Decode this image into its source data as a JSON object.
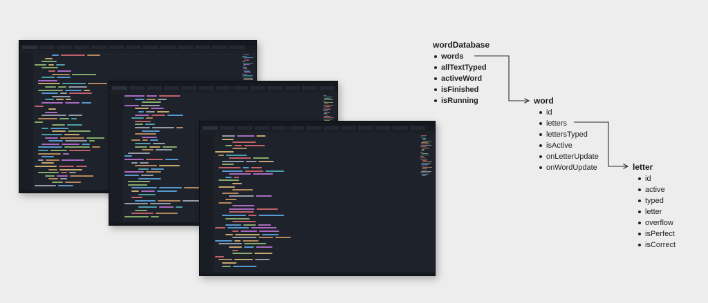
{
  "tree": {
    "wordDatabase": {
      "title": "wordDatabase",
      "items": [
        "words",
        "allTextTyped",
        "activeWord",
        "isFinished",
        "isRunning"
      ]
    },
    "word": {
      "title": "word",
      "items": [
        "id",
        "letters",
        "lettersTyped",
        "isActive",
        "onLetterUpdate",
        "onWordUpdate"
      ]
    },
    "letter": {
      "title": "letter",
      "items": [
        "id",
        "active",
        "typed",
        "letter",
        "overflow",
        "isPerfect",
        "isCorrect"
      ]
    }
  },
  "colors": {
    "background": "#ededed",
    "editor_bg": "#1e222a",
    "text": "#1b1b1b",
    "connector": "#2a2a2a"
  }
}
